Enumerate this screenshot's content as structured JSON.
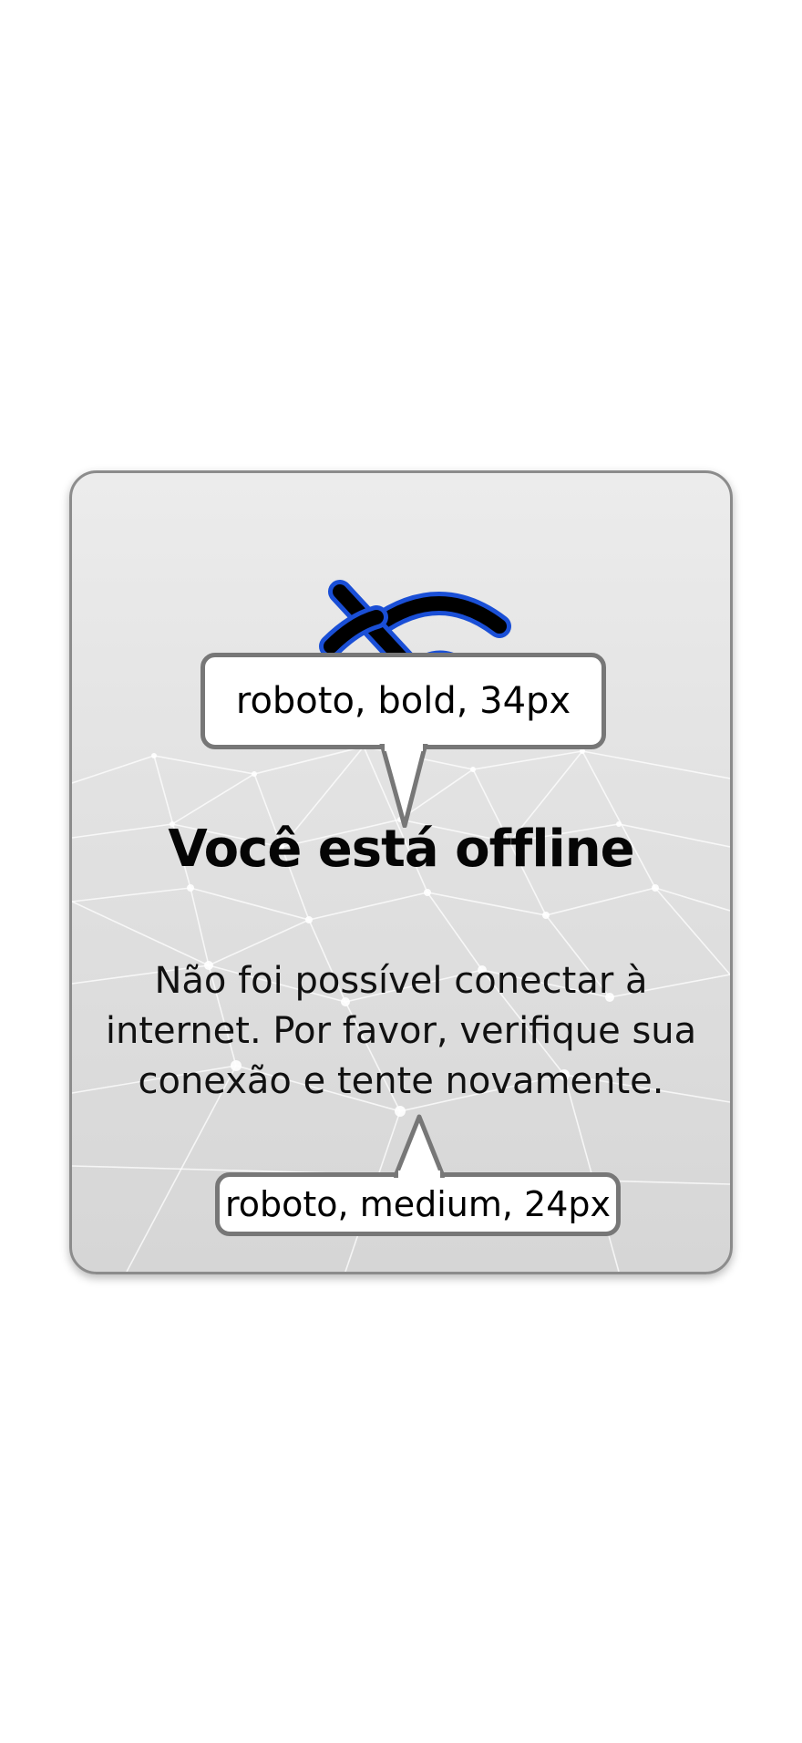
{
  "offline_card": {
    "title": "Você está offline",
    "message": "Não foi possível conectar à internet. Por favor, verifique sua conexão e tente novamente.",
    "icon": "wifi-off-icon"
  },
  "annotations": {
    "title_font": "roboto, bold, 34px",
    "message_font": "roboto, medium, 24px"
  },
  "colors": {
    "icon_outline": "#1a4fd6",
    "icon_fill": "#000000",
    "callout_border": "#777777",
    "card_border": "#8c8c8c"
  }
}
